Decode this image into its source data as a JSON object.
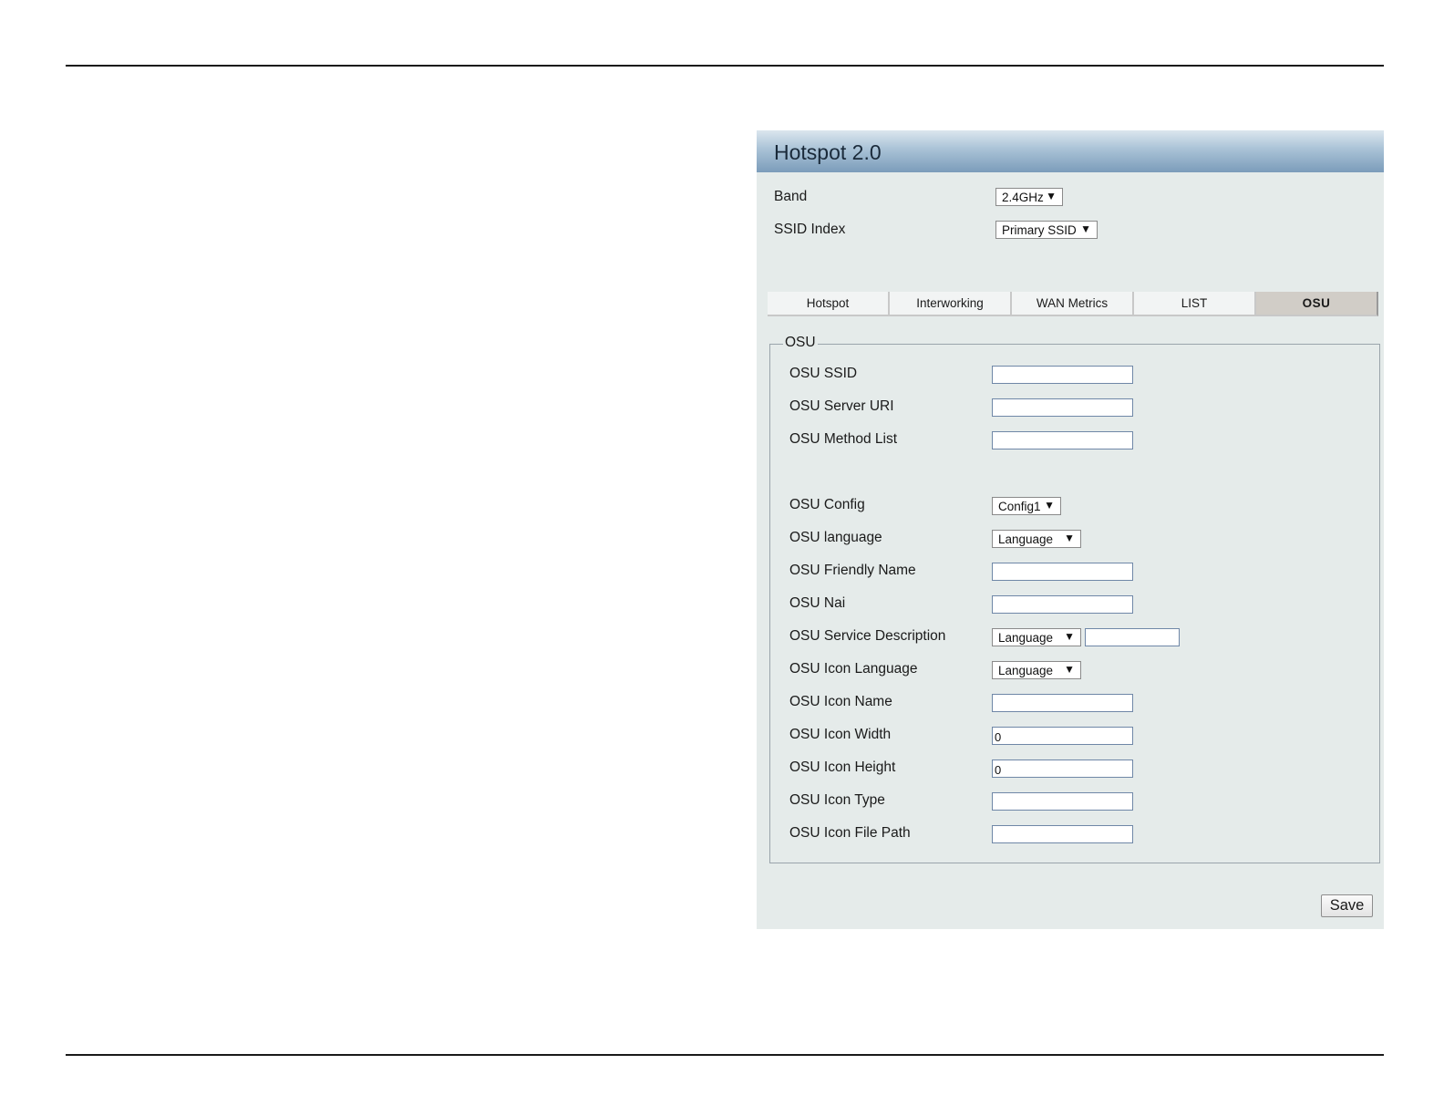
{
  "panel": {
    "title": "Hotspot 2.0"
  },
  "band": {
    "label": "Band",
    "value": "2.4GHz"
  },
  "ssid_index": {
    "label": "SSID Index",
    "value": "Primary SSID"
  },
  "tabs": [
    {
      "label": "Hotspot",
      "active": false
    },
    {
      "label": "Interworking",
      "active": false
    },
    {
      "label": "WAN Metrics",
      "active": false
    },
    {
      "label": "LIST",
      "active": false
    },
    {
      "label": "OSU",
      "active": true
    }
  ],
  "osu": {
    "legend": "OSU",
    "ssid": {
      "label": "OSU SSID",
      "value": ""
    },
    "server_uri": {
      "label": "OSU Server URI",
      "value": ""
    },
    "method_list": {
      "label": "OSU Method List",
      "value": ""
    },
    "config": {
      "label": "OSU Config",
      "value": "Config1"
    },
    "language": {
      "label": "OSU language",
      "value": "Language"
    },
    "friendly_name": {
      "label": "OSU Friendly Name",
      "value": ""
    },
    "nai": {
      "label": "OSU Nai",
      "value": ""
    },
    "service_description": {
      "label": "OSU Service Description",
      "select_value": "Language",
      "value": ""
    },
    "icon_language": {
      "label": "OSU Icon Language",
      "value": "Language"
    },
    "icon_name": {
      "label": "OSU Icon Name",
      "value": ""
    },
    "icon_width": {
      "label": "OSU Icon Width",
      "value": "0"
    },
    "icon_height": {
      "label": "OSU Icon Height",
      "value": "0"
    },
    "icon_type": {
      "label": "OSU Icon Type",
      "value": ""
    },
    "icon_file_path": {
      "label": "OSU Icon File Path",
      "value": ""
    }
  },
  "save_label": "Save",
  "icons": {
    "dropdown": "triangle-down-icon"
  }
}
